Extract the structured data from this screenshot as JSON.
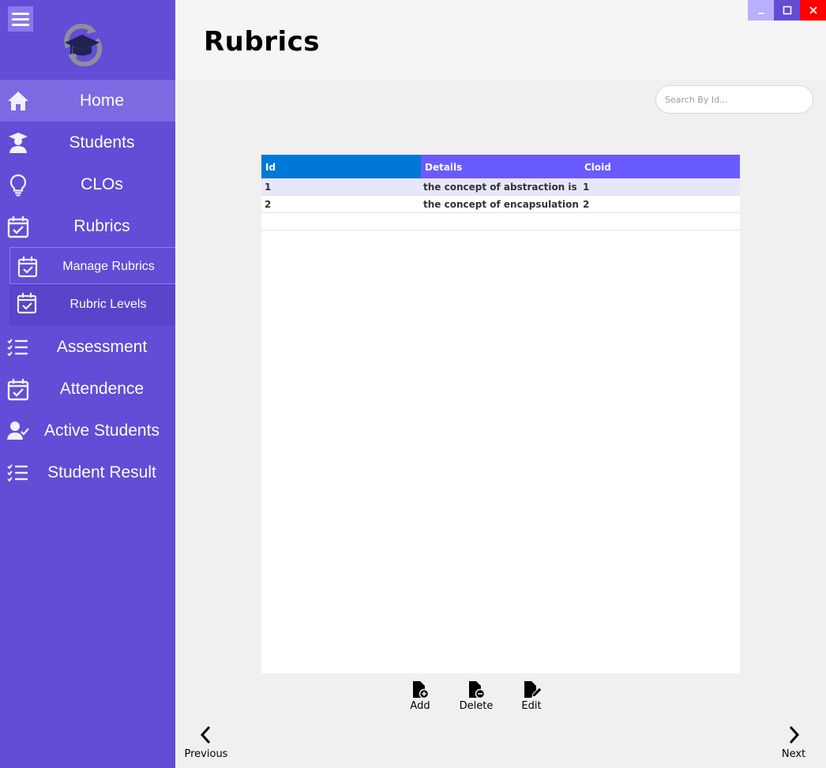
{
  "window": {
    "min_glyph": "_",
    "max_glyph": "☐",
    "close_glyph": "✕"
  },
  "header": {
    "title": "Rubrics"
  },
  "search": {
    "placeholder": "Search By Id..."
  },
  "sidebar": {
    "items": [
      {
        "label": "Home",
        "icon": "home-icon"
      },
      {
        "label": "Students",
        "icon": "student-icon"
      },
      {
        "label": "CLOs",
        "icon": "lightbulb-icon"
      },
      {
        "label": "Rubrics",
        "icon": "calendar-check-icon"
      },
      {
        "label": "Assessment",
        "icon": "checklist-icon"
      },
      {
        "label": "Attendence",
        "icon": "calendar-check-icon"
      },
      {
        "label": "Active Students",
        "icon": "user-check-icon"
      },
      {
        "label": "Student Result",
        "icon": "checklist-icon"
      }
    ],
    "sub_items": [
      {
        "label": "Manage Rubrics",
        "icon": "calendar-check-icon"
      },
      {
        "label": "Rubric Levels",
        "icon": "calendar-check-icon"
      }
    ]
  },
  "table": {
    "columns": [
      "Id",
      "Details",
      "Cloid"
    ],
    "rows": [
      [
        "1",
        "the concept of abstraction is ...",
        "1"
      ],
      [
        "2",
        "the concept of encapsulation...",
        "2"
      ]
    ]
  },
  "actions": {
    "add": "Add",
    "delete": "Delete",
    "edit": "Edit"
  },
  "pager": {
    "previous": "Previous",
    "next": "Next"
  },
  "colors": {
    "sidebar": "#634cd6",
    "sidebar_active": "#7d69e2",
    "header_id_column": "#0078d7",
    "header_columns": "#6a5bff",
    "selected_row": "#e8e6fb",
    "close_button": "#ff0000"
  }
}
